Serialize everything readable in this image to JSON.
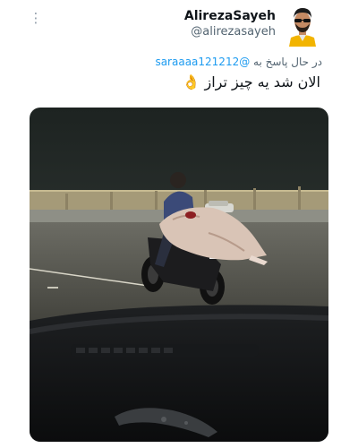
{
  "tweet": {
    "author_name": "AlirezaSayeh",
    "author_handle": "@alirezasayeh",
    "reply_prefix": "در حال پاسخ به",
    "reply_to": "@saraaaa121212",
    "text": "الان شد یه چیز تراز",
    "emoji": "👌",
    "more_icon": "⋮"
  }
}
